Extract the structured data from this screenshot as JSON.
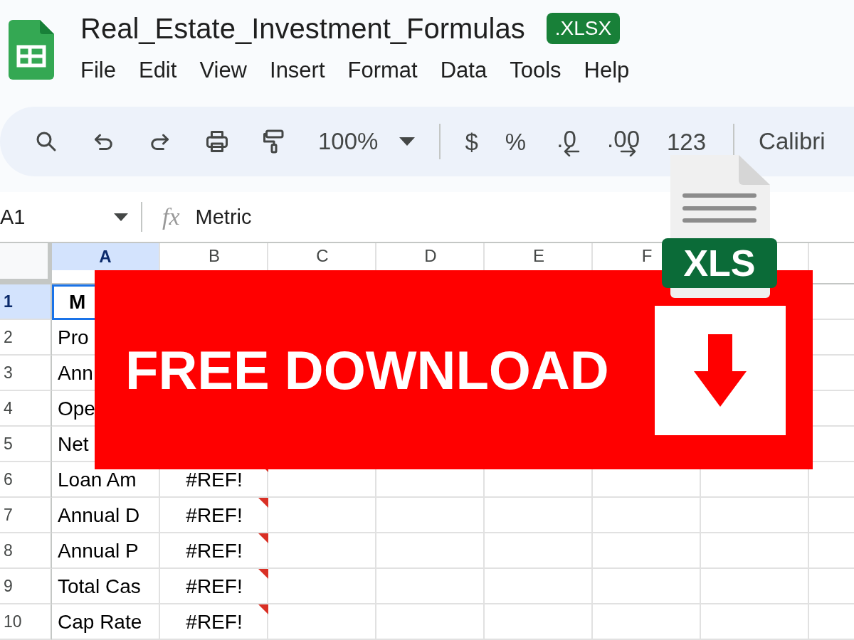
{
  "file": {
    "title": "Real_Estate_Investment_Formulas",
    "badge": ".XLSX"
  },
  "menu": [
    "File",
    "Edit",
    "View",
    "Insert",
    "Format",
    "Data",
    "Tools",
    "Help"
  ],
  "toolbar": {
    "zoom": "100%",
    "font": "Calibri",
    "formats": [
      {
        "label": "$",
        "kind": "plain"
      },
      {
        "label": "%",
        "kind": "plain"
      },
      {
        "label": ".0",
        "kind": "decrease"
      },
      {
        "label": ".00",
        "kind": "increase"
      },
      {
        "label": "123",
        "kind": "plain"
      }
    ]
  },
  "formula_bar": {
    "cell": "A1",
    "function_label": "fx",
    "value": "Metric"
  },
  "columns": [
    {
      "label": "A",
      "selected": true
    },
    {
      "label": "B",
      "selected": false
    },
    {
      "label": "C",
      "selected": false
    },
    {
      "label": "D",
      "selected": false
    },
    {
      "label": "E",
      "selected": false
    },
    {
      "label": "F",
      "selected": false
    }
  ],
  "rows": [
    {
      "number": "1",
      "a": "M",
      "bold": true,
      "selected": true
    },
    {
      "number": "2",
      "a": "Pro",
      "bold": false,
      "selected": false
    },
    {
      "number": "3",
      "a": "Ann",
      "bold": false,
      "selected": false
    },
    {
      "number": "4",
      "a": "Ope",
      "bold": false,
      "selected": false
    },
    {
      "number": "5",
      "a": "Net",
      "bold": false,
      "selected": false
    },
    {
      "number": "6",
      "a": "Loan Am",
      "b": "#REF!",
      "flagged": true,
      "bold": false,
      "selected": false
    },
    {
      "number": "7",
      "a": "Annual D",
      "b": "#REF!",
      "flagged": true,
      "bold": false,
      "selected": false
    },
    {
      "number": "8",
      "a": "Annual P",
      "b": "#REF!",
      "flagged": true,
      "bold": false,
      "selected": false
    },
    {
      "number": "9",
      "a": "Total Cas",
      "b": "#REF!",
      "flagged": true,
      "bold": false,
      "selected": false
    },
    {
      "number": "10",
      "a": "Cap Rate",
      "b": "#REF!",
      "flagged": true,
      "bold": false,
      "selected": false
    }
  ],
  "banner": {
    "title": "FREE DOWNLOAD"
  },
  "file_icon": {
    "badge": "XLS"
  }
}
